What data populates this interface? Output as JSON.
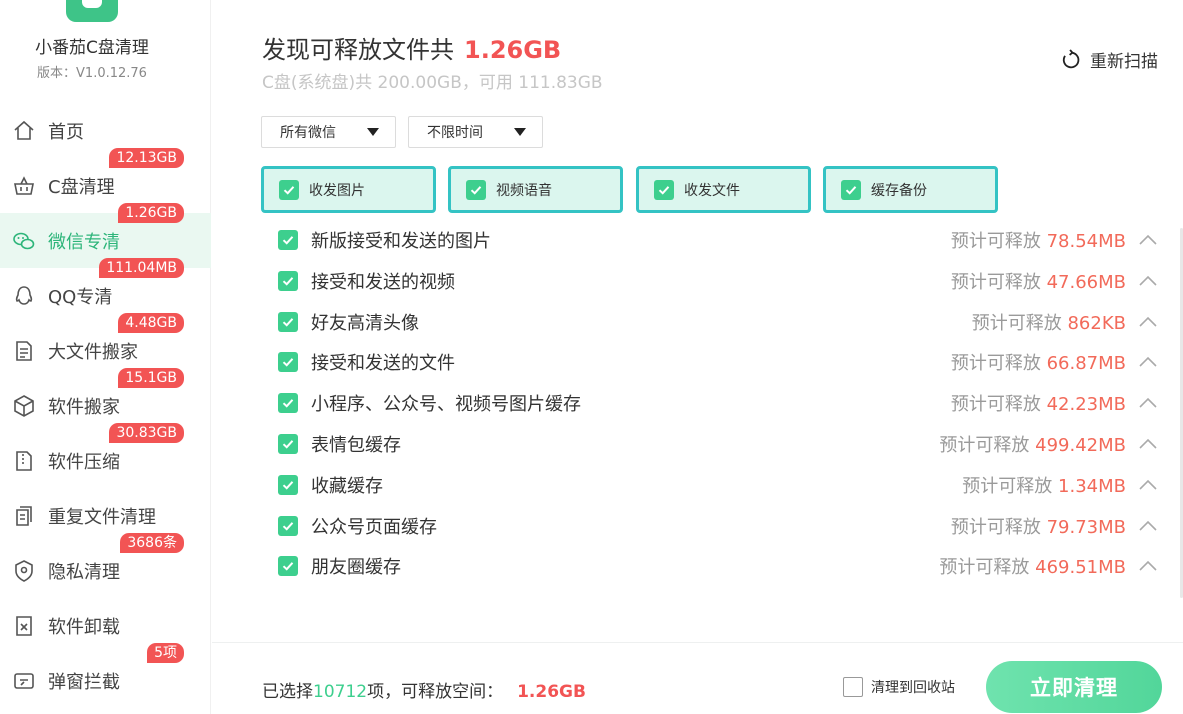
{
  "app": {
    "name": "小番茄C盘清理",
    "version": "版本：V1.0.12.76"
  },
  "nav": [
    {
      "label": "首页",
      "badge": "",
      "icon": "home-icon"
    },
    {
      "label": "C盘清理",
      "badge": "12.13GB",
      "icon": "basket-icon"
    },
    {
      "label": "微信专清",
      "badge": "1.26GB",
      "icon": "wechat-icon",
      "active": true
    },
    {
      "label": "QQ专清",
      "badge": "111.04MB",
      "icon": "qq-icon"
    },
    {
      "label": "大文件搬家",
      "badge": "4.48GB",
      "icon": "large-file-icon"
    },
    {
      "label": "软件搬家",
      "badge": "15.1GB",
      "icon": "box-icon"
    },
    {
      "label": "软件压缩",
      "badge": "30.83GB",
      "icon": "zip-icon"
    },
    {
      "label": "重复文件清理",
      "badge": "",
      "icon": "duplicate-icon"
    },
    {
      "label": "隐私清理",
      "badge": "3686条",
      "icon": "privacy-icon"
    },
    {
      "label": "软件卸载",
      "badge": "",
      "icon": "uninstall-icon"
    },
    {
      "label": "弹窗拦截",
      "badge": "5项",
      "icon": "popup-icon"
    }
  ],
  "header": {
    "title": "发现可释放文件共",
    "total_size": "1.26GB",
    "subtitle": "C盘(系统盘)共 200.00GB，可用 111.83GB",
    "rescan_label": "重新扫描"
  },
  "filters": {
    "wechat_select": "所有微信",
    "time_select": "不限时间"
  },
  "categories": [
    {
      "label": "收发图片",
      "checked": true
    },
    {
      "label": "视频语音",
      "checked": true
    },
    {
      "label": "收发文件",
      "checked": true
    },
    {
      "label": "缓存备份",
      "checked": true
    }
  ],
  "items": [
    {
      "label": "新版接受和发送的图片",
      "prefix": "预计可释放",
      "amount": "78.54MB",
      "checked": true
    },
    {
      "label": "接受和发送的视频",
      "prefix": "预计可释放",
      "amount": "47.66MB",
      "checked": true
    },
    {
      "label": "好友高清头像",
      "prefix": "预计可释放",
      "amount": "862KB",
      "checked": true
    },
    {
      "label": "接受和发送的文件",
      "prefix": "预计可释放",
      "amount": "66.87MB",
      "checked": true
    },
    {
      "label": "小程序、公众号、视频号图片缓存",
      "prefix": "预计可释放",
      "amount": "42.23MB",
      "checked": true
    },
    {
      "label": "表情包缓存",
      "prefix": "预计可释放",
      "amount": "499.42MB",
      "checked": true
    },
    {
      "label": "收藏缓存",
      "prefix": "预计可释放",
      "amount": "1.34MB",
      "checked": true
    },
    {
      "label": "公众号页面缓存",
      "prefix": "预计可释放",
      "amount": "79.73MB",
      "checked": true
    },
    {
      "label": "朋友圈缓存",
      "prefix": "预计可释放",
      "amount": "469.51MB",
      "checked": true
    }
  ],
  "footer": {
    "selected_prefix": "已选择",
    "selected_count": "10712",
    "selected_suffix": "项，可释放空间：",
    "selected_size": "1.26GB",
    "recycle_label": "清理到回收站",
    "recycle_checked": false,
    "clean_button": "立即清理"
  },
  "colors": {
    "accent": "#3dcf8e",
    "danger": "#f25454",
    "category_border": "#34c3c4"
  }
}
